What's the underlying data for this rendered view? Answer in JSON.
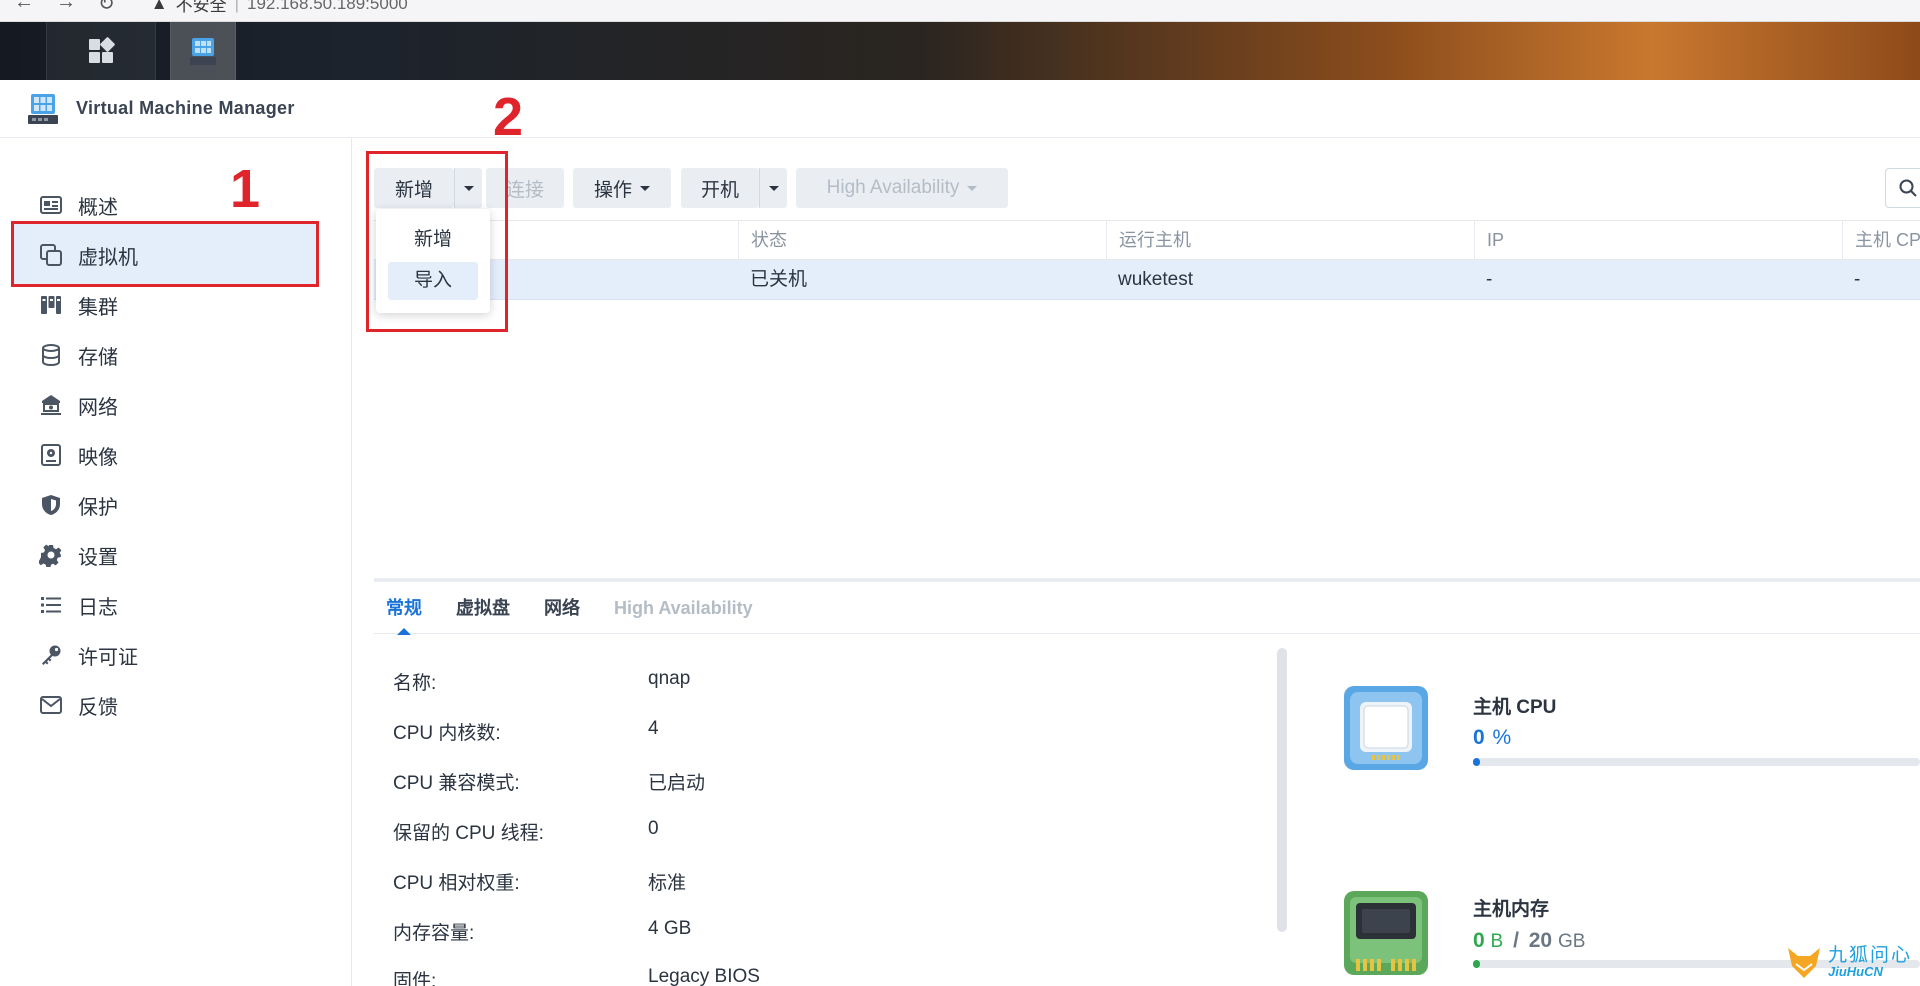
{
  "browser": {
    "security_label": "不安全",
    "url": "192.168.50.189:5000"
  },
  "app": {
    "title": "Virtual Machine Manager"
  },
  "sidebar": {
    "items": [
      {
        "label": "概述",
        "icon": "overview-icon"
      },
      {
        "label": "虚拟机",
        "icon": "virtual-machine-icon",
        "active": true
      },
      {
        "label": "集群",
        "icon": "cluster-icon"
      },
      {
        "label": "存储",
        "icon": "storage-icon"
      },
      {
        "label": "网络",
        "icon": "network-icon"
      },
      {
        "label": "映像",
        "icon": "image-icon"
      },
      {
        "label": "保护",
        "icon": "shield-icon"
      },
      {
        "label": "设置",
        "icon": "gear-icon"
      },
      {
        "label": "日志",
        "icon": "log-list-icon"
      },
      {
        "label": "许可证",
        "icon": "key-icon"
      },
      {
        "label": "反馈",
        "icon": "mail-icon"
      }
    ]
  },
  "toolbar": {
    "new_label": "新增",
    "connect_label": "连接",
    "action_label": "操作",
    "power_on_label": "开机",
    "ha_label": "High Availability"
  },
  "new_menu": {
    "items": [
      "新增",
      "导入"
    ]
  },
  "table": {
    "columns": [
      "状态",
      "运行主机",
      "IP",
      "主机 CPU"
    ],
    "rows": [
      {
        "status": "已关机",
        "host": "wuketest",
        "ip": "-",
        "cpu": "-"
      }
    ]
  },
  "annotations": {
    "marker_1": "1",
    "marker_2": "2"
  },
  "detail_tabs": [
    "常规",
    "虚拟盘",
    "网络",
    "High Availability"
  ],
  "properties": [
    {
      "label": "名称:",
      "value": "qnap"
    },
    {
      "label": "CPU 内核数:",
      "value": "4"
    },
    {
      "label": "CPU 兼容模式:",
      "value": "已启动"
    },
    {
      "label": "保留的 CPU 线程:",
      "value": "0"
    },
    {
      "label": "CPU 相对权重:",
      "value": "标准"
    },
    {
      "label": "内存容量:",
      "value": "4 GB"
    },
    {
      "label": "固件:",
      "value": "Legacy BIOS"
    }
  ],
  "resources": {
    "cpu": {
      "title": "主机 CPU",
      "value": "0",
      "unit": "%",
      "fraction": 0.0,
      "color": "#1a73d9"
    },
    "memory": {
      "title": "主机内存",
      "used": "0",
      "used_unit": "B",
      "separator": "/",
      "total": "20",
      "total_unit": "GB",
      "fraction": 0.0,
      "color": "#2ea84f"
    }
  },
  "watermark": {
    "cn": "九狐问心",
    "en": "JiuHuCN"
  },
  "colors": {
    "accent": "#1a73d9",
    "selection": "#e4eefb",
    "annotation": "#e0242b"
  }
}
